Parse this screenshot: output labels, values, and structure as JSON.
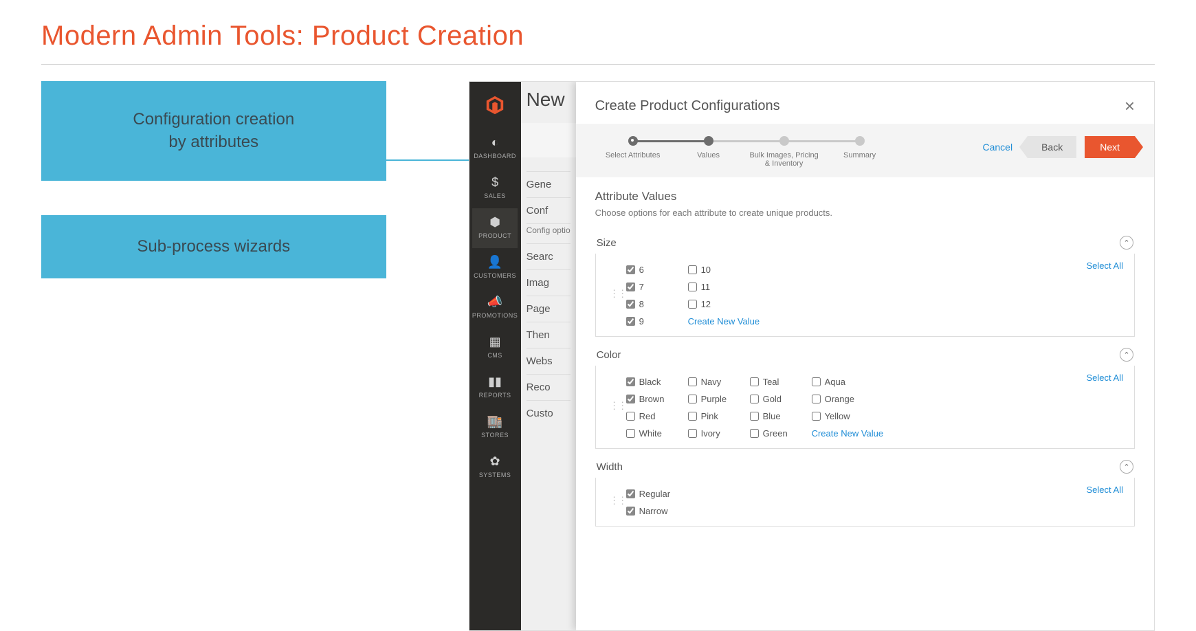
{
  "slide": {
    "title": "Modern Admin Tools: Product Creation",
    "callout1_line1": "Configuration creation",
    "callout1_line2": "by attributes",
    "callout2": "Sub-process wizards"
  },
  "nav": {
    "items": [
      {
        "icon": "dash",
        "label": "DASHBOARD"
      },
      {
        "icon": "dollar",
        "label": "SALES"
      },
      {
        "icon": "cube",
        "label": "PRODUCT",
        "active": true
      },
      {
        "icon": "person",
        "label": "CUSTOMERS"
      },
      {
        "icon": "megaphone",
        "label": "PROMOTIONS"
      },
      {
        "icon": "grid",
        "label": "CMS"
      },
      {
        "icon": "bars",
        "label": "REPORTS"
      },
      {
        "icon": "store",
        "label": "STORES"
      },
      {
        "icon": "gear",
        "label": "SYSTEMS"
      }
    ]
  },
  "under": {
    "title": "New",
    "sections": [
      "Gene",
      "Conf"
    ],
    "desc": "Config option produ (Ex: a p",
    "sections2": [
      "Searc",
      "Imag",
      "Page",
      "Then",
      "Webs",
      "Reco",
      "Custo"
    ]
  },
  "modal": {
    "title": "Create Product Configurations",
    "steps": [
      {
        "label": "Select Attributes",
        "state": "done"
      },
      {
        "label": "Values",
        "state": "active"
      },
      {
        "label": "Bulk Images, Pricing & Inventory",
        "state": ""
      },
      {
        "label": "Summary",
        "state": ""
      }
    ],
    "actions": {
      "cancel": "Cancel",
      "back": "Back",
      "next": "Next"
    },
    "body": {
      "title": "Attribute Values",
      "sub": "Choose options for each attribute to create unique products.",
      "select_all": "Select All",
      "create_new": "Create New Value",
      "attrs": [
        {
          "name": "Size",
          "cols": [
            [
              {
                "label": "6",
                "checked": true
              },
              {
                "label": "7",
                "checked": true
              },
              {
                "label": "8",
                "checked": true
              },
              {
                "label": "9",
                "checked": true
              }
            ],
            [
              {
                "label": "10",
                "checked": false
              },
              {
                "label": "11",
                "checked": false
              },
              {
                "label": "12",
                "checked": false
              }
            ]
          ],
          "show_create": true
        },
        {
          "name": "Color",
          "cols": [
            [
              {
                "label": "Black",
                "checked": true
              },
              {
                "label": "Brown",
                "checked": true
              },
              {
                "label": "Red",
                "checked": false
              },
              {
                "label": "White",
                "checked": false
              }
            ],
            [
              {
                "label": "Navy",
                "checked": false
              },
              {
                "label": "Purple",
                "checked": false
              },
              {
                "label": "Pink",
                "checked": false
              },
              {
                "label": "Ivory",
                "checked": false
              }
            ],
            [
              {
                "label": "Teal",
                "checked": false
              },
              {
                "label": "Gold",
                "checked": false
              },
              {
                "label": "Blue",
                "checked": false
              },
              {
                "label": "Green",
                "checked": false
              }
            ],
            [
              {
                "label": "Aqua",
                "checked": false
              },
              {
                "label": "Orange",
                "checked": false
              },
              {
                "label": "Yellow",
                "checked": false
              }
            ]
          ],
          "show_create": true,
          "create_in_last_col": true
        },
        {
          "name": "Width",
          "cols": [
            [
              {
                "label": "Regular",
                "checked": true
              },
              {
                "label": "Narrow",
                "checked": true
              }
            ]
          ],
          "show_create": false
        }
      ]
    }
  }
}
